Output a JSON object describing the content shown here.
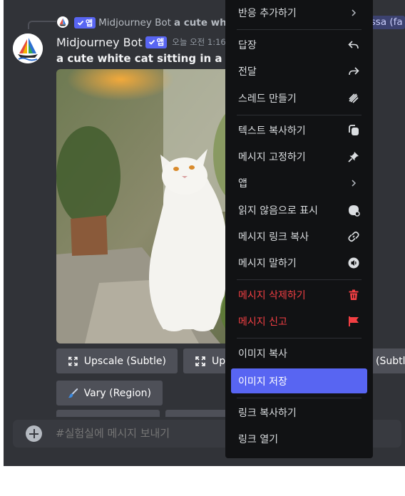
{
  "reply": {
    "author": "Midjourney Bot",
    "app_badge": "앱",
    "snippet": "a cute whi",
    "mention_fragment": "issa (fa"
  },
  "message": {
    "author": "Midjourney Bot",
    "app_badge": "앱",
    "timestamp": "오늘 오전 1:16",
    "prompt": "a cute white cat sitting in a gar"
  },
  "buttons": {
    "upscale_subtle": "Upscale (Subtle)",
    "upscale_creative_partial": "Up",
    "redo_subtle_partial": "(Subtl",
    "vary_region": "Vary (Region)"
  },
  "composer": {
    "placeholder": "#실험실에 메시지 보내기"
  },
  "context_menu": {
    "add_reaction": "반응 추가하기",
    "reply": "답장",
    "forward": "전달",
    "create_thread": "스레드 만들기",
    "copy_text": "텍스트 복사하기",
    "pin_message": "메시지 고정하기",
    "apps": "앱",
    "mark_unread": "읽지 않음으로 표시",
    "copy_message_link": "메시지 링크 복사",
    "speak_message": "메시지 말하기",
    "delete_message": "메시지 삭제하기",
    "report_message": "메시지 신고",
    "copy_image": "이미지 복사",
    "save_image": "이미지 저장",
    "copy_link": "링크 복사하기",
    "open_link": "링크 열기"
  },
  "colors": {
    "chat_bg": "#313338",
    "menu_bg": "#111214",
    "accent": "#5865f2",
    "danger": "#f23f43",
    "button_bg": "#4e5058"
  }
}
